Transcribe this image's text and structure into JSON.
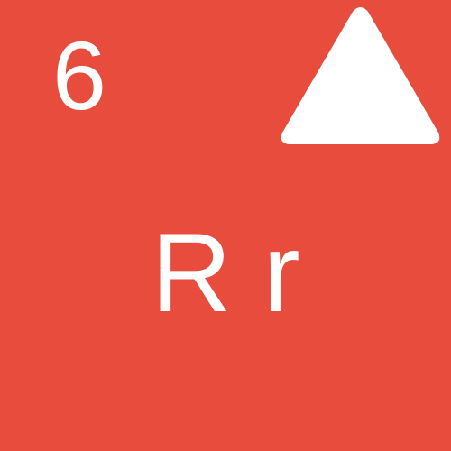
{
  "card": {
    "number": "6",
    "letters": "R r",
    "icon": "triangle-up-icon",
    "background_color": "#e74c3c",
    "foreground_color": "#ffffff"
  }
}
